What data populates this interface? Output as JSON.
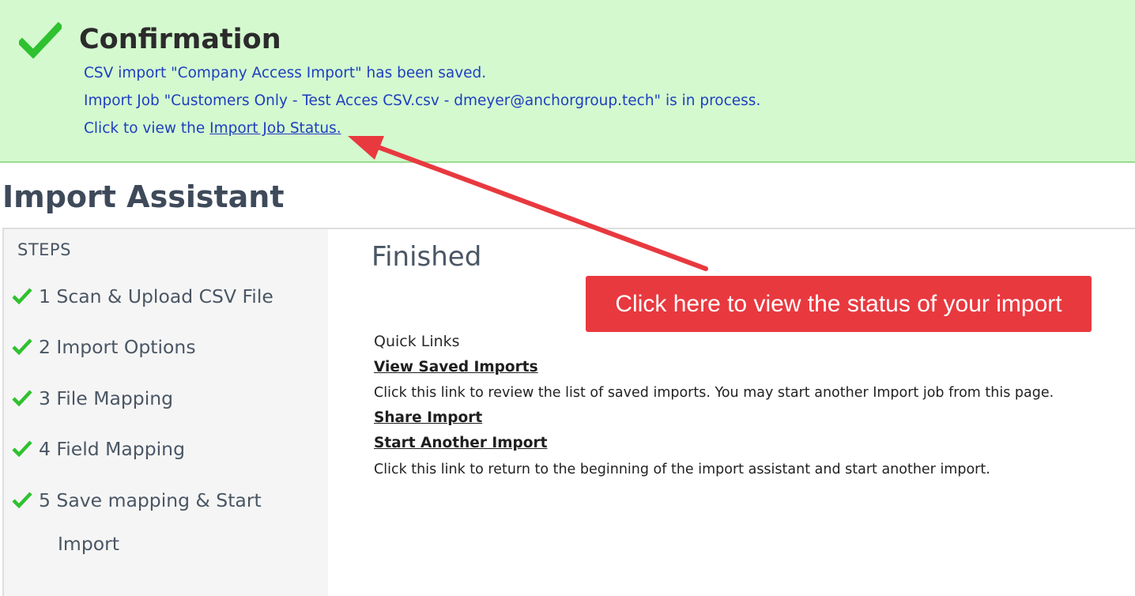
{
  "confirmation": {
    "title": "Confirmation",
    "line1": "CSV import \"Company Access Import\" has been saved.",
    "line2": "Import Job \"Customers Only - Test Acces CSV.csv - dmeyer@anchorgroup.tech\" is in process.",
    "line3_prefix": "Click to view the ",
    "status_link": "Import Job Status.",
    "colors": {
      "background": "#d4f9cf",
      "text": "#1d3fbf",
      "check": "#2fc12f"
    }
  },
  "page_title": "Import Assistant",
  "sidebar": {
    "heading": "STEPS",
    "steps": [
      {
        "label": "1 Scan & Upload CSV File",
        "icon": "checkmark-icon"
      },
      {
        "label": "2 Import Options",
        "icon": "checkmark-icon"
      },
      {
        "label": "3 File Mapping",
        "icon": "checkmark-icon"
      },
      {
        "label": "4 Field Mapping",
        "icon": "checkmark-icon"
      },
      {
        "label": "5 Save mapping & Start",
        "label_cont": "Import",
        "icon": "checkmark-icon"
      }
    ]
  },
  "main": {
    "heading": "Finished",
    "quick_links_label": "Quick Links",
    "links": [
      {
        "label": "View Saved Imports",
        "description": "Click this link to review the list of saved imports. You may start another Import job from this page."
      },
      {
        "label": "Share Import",
        "description": ""
      },
      {
        "label": "Start Another Import",
        "description": "Click this link to return to the beginning of the import assistant and start another import."
      }
    ]
  },
  "annotation": {
    "callout_text": "Click here to view the status of your import",
    "color": "#e8393f"
  }
}
